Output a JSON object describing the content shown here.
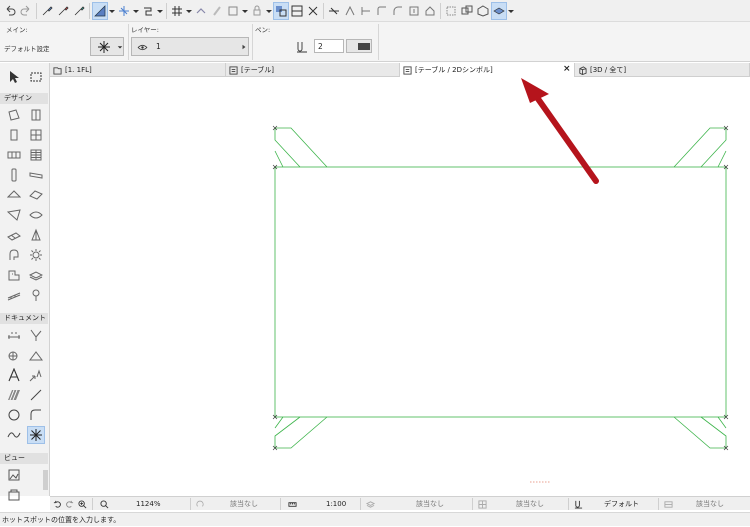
{
  "infobox": {
    "main_label": "メイン:",
    "default_settings": "デフォルト設定",
    "layer_label": "レイヤー:",
    "layer_value": "1",
    "pen_label": "ペン:",
    "pen_value": "2"
  },
  "tabs": [
    {
      "label": "[1. 1FL]"
    },
    {
      "label": "[テーブル]"
    },
    {
      "label": "[テーブル / 2Dシンボル]",
      "active": true
    },
    {
      "label": "[3D / 全て]"
    }
  ],
  "toolbox": {
    "design_header": "デザイン",
    "document_header": "ドキュメント",
    "view_header": "ビュー"
  },
  "navbar": {
    "zoom": "1124%",
    "filter1": "該当なし",
    "scale": "1:100",
    "filter2": "該当なし",
    "filter3": "該当なし",
    "pen_set": "デフォルト",
    "filter4": "該当なし"
  },
  "status": {
    "message": "ホットスポットの位置を入力します。"
  },
  "colors": {
    "drawing_line": "#3cb44a",
    "arrow": "#b5141c",
    "selection_blue": "#c9def5"
  }
}
